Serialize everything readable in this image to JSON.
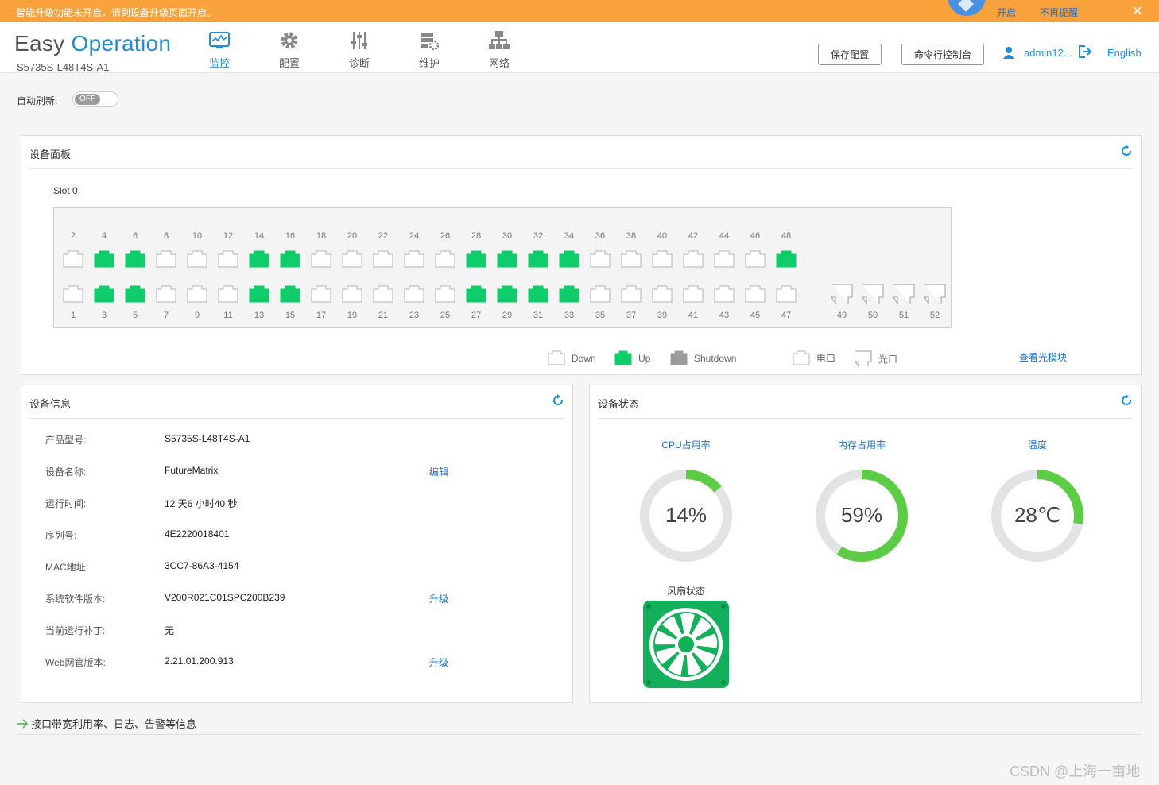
{
  "topbar": {
    "message": "智能升级功能未开启，请到设备升级页面开启。",
    "enable_link": "开启",
    "no_remind_link": "不再提醒",
    "close_glyph": "✕",
    "color": "#f9a13a"
  },
  "header": {
    "brand_word1": "Easy",
    "brand_word2": "Operation",
    "model": "S5735S-L48T4S-A1",
    "nav": [
      {
        "label": "监控",
        "icon": "monitor-icon",
        "active": true
      },
      {
        "label": "配置",
        "icon": "gear-icon",
        "active": false
      },
      {
        "label": "诊断",
        "icon": "sliders-icon",
        "active": false
      },
      {
        "label": "维护",
        "icon": "maintenance-icon",
        "active": false
      },
      {
        "label": "网络",
        "icon": "topology-icon",
        "active": false
      }
    ],
    "save_config": "保存配置",
    "cli_console": "命令行控制台",
    "user": "admin12...",
    "language": "English",
    "accent": "#1e8ddb"
  },
  "auto_refresh": {
    "label": "自动刷新:",
    "state": "OFF"
  },
  "device_panel": {
    "title": "设备面板",
    "slot": "Slot 0",
    "status_colors": {
      "up": "#10cd6c",
      "down": "#ffffff",
      "shutdown": "#9c9c9c"
    },
    "top_row": [
      {
        "num": "2",
        "status": "down"
      },
      {
        "num": "4",
        "status": "up"
      },
      {
        "num": "6",
        "status": "up"
      },
      {
        "num": "8",
        "status": "down"
      },
      {
        "num": "10",
        "status": "down"
      },
      {
        "num": "12",
        "status": "down"
      },
      {
        "num": "14",
        "status": "up"
      },
      {
        "num": "16",
        "status": "up"
      },
      {
        "num": "18",
        "status": "down"
      },
      {
        "num": "20",
        "status": "down"
      },
      {
        "num": "22",
        "status": "down"
      },
      {
        "num": "24",
        "status": "down"
      },
      {
        "num": "26",
        "status": "down"
      },
      {
        "num": "28",
        "status": "up"
      },
      {
        "num": "30",
        "status": "up"
      },
      {
        "num": "32",
        "status": "up"
      },
      {
        "num": "34",
        "status": "up"
      },
      {
        "num": "36",
        "status": "down"
      },
      {
        "num": "38",
        "status": "down"
      },
      {
        "num": "40",
        "status": "down"
      },
      {
        "num": "42",
        "status": "down"
      },
      {
        "num": "44",
        "status": "down"
      },
      {
        "num": "46",
        "status": "down"
      },
      {
        "num": "48",
        "status": "up"
      }
    ],
    "bottom_row": [
      {
        "num": "1",
        "status": "down"
      },
      {
        "num": "3",
        "status": "up"
      },
      {
        "num": "5",
        "status": "up"
      },
      {
        "num": "7",
        "status": "down"
      },
      {
        "num": "9",
        "status": "down"
      },
      {
        "num": "11",
        "status": "down"
      },
      {
        "num": "13",
        "status": "up"
      },
      {
        "num": "15",
        "status": "up"
      },
      {
        "num": "17",
        "status": "down"
      },
      {
        "num": "19",
        "status": "down"
      },
      {
        "num": "21",
        "status": "down"
      },
      {
        "num": "23",
        "status": "down"
      },
      {
        "num": "25",
        "status": "down"
      },
      {
        "num": "27",
        "status": "up"
      },
      {
        "num": "29",
        "status": "up"
      },
      {
        "num": "31",
        "status": "up"
      },
      {
        "num": "33",
        "status": "up"
      },
      {
        "num": "35",
        "status": "down"
      },
      {
        "num": "37",
        "status": "down"
      },
      {
        "num": "39",
        "status": "down"
      },
      {
        "num": "41",
        "status": "down"
      },
      {
        "num": "43",
        "status": "down"
      },
      {
        "num": "45",
        "status": "down"
      },
      {
        "num": "47",
        "status": "down"
      }
    ],
    "sfp_ports": [
      {
        "num": "49",
        "status": "down"
      },
      {
        "num": "50",
        "status": "down"
      },
      {
        "num": "51",
        "status": "down"
      },
      {
        "num": "52",
        "status": "down"
      }
    ],
    "legend": {
      "down": "Down",
      "up": "Up",
      "shutdown": "Shutdown",
      "electric": "电口",
      "optical": "光口",
      "view_optical": "查看光模块"
    }
  },
  "device_info": {
    "title": "设备信息",
    "rows": [
      {
        "label": "产品型号:",
        "value": "S5735S-L48T4S-A1",
        "action": ""
      },
      {
        "label": "设备名称:",
        "value": "FutureMatrix",
        "action": "编辑"
      },
      {
        "label": "运行时间:",
        "value": "12 天6 小时40 秒",
        "action": ""
      },
      {
        "label": "序列号:",
        "value": "4E2220018401",
        "action": ""
      },
      {
        "label": "MAC地址:",
        "value": "3CC7-86A3-4154",
        "action": ""
      },
      {
        "label": "系统软件版本:",
        "value": "V200R021C01SPC200B239",
        "action": "升级"
      },
      {
        "label": "当前运行补丁:",
        "value": "无",
        "action": ""
      },
      {
        "label": "Web网管版本:",
        "value": "2.21.01.200.913",
        "action": "升级"
      }
    ]
  },
  "device_status": {
    "title": "设备状态",
    "gauges": [
      {
        "title": "CPU占用率",
        "value_text": "14%",
        "fraction": 0.14
      },
      {
        "title": "内存占用率",
        "value_text": "59%",
        "fraction": 0.59
      },
      {
        "title": "温度",
        "value_text": "28℃",
        "fraction": 0.28
      }
    ],
    "fan_title": "风扇状态",
    "gauge_color": "#5dcc45",
    "track_color": "#e3e3e3"
  },
  "bottom": {
    "link_text": "接口带宽利用率、日志、告警等信息"
  },
  "watermark": "CSDN @上海一亩地"
}
